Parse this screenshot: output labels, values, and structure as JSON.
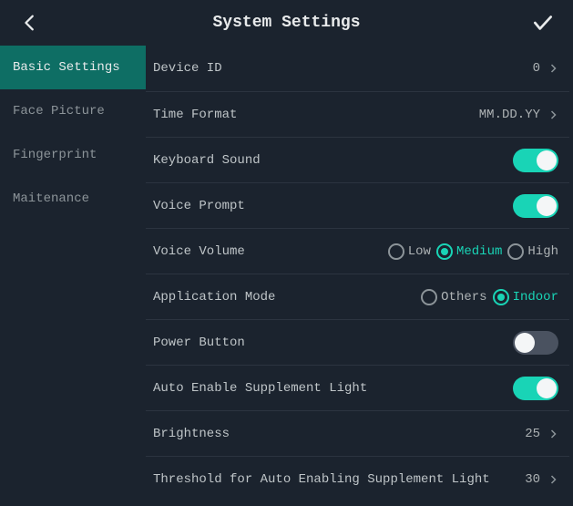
{
  "header": {
    "title": "System Settings"
  },
  "sidebar": {
    "items": [
      {
        "label": "Basic Settings",
        "active": true
      },
      {
        "label": "Face Picture",
        "active": false
      },
      {
        "label": "Fingerprint",
        "active": false
      },
      {
        "label": "Maitenance",
        "active": false
      }
    ]
  },
  "settings": {
    "device_id": {
      "label": "Device ID",
      "value": "0"
    },
    "time_format": {
      "label": "Time Format",
      "value": "MM.DD.YY"
    },
    "keyboard_sound": {
      "label": "Keyboard Sound",
      "on": true
    },
    "voice_prompt": {
      "label": "Voice Prompt",
      "on": true
    },
    "voice_volume": {
      "label": "Voice Volume",
      "options": [
        "Low",
        "Medium",
        "High"
      ],
      "selected": "Medium"
    },
    "application_mode": {
      "label": "Application Mode",
      "options": [
        "Others",
        "Indoor"
      ],
      "selected": "Indoor"
    },
    "power_button": {
      "label": "Power Button",
      "on": false
    },
    "auto_supplement_light": {
      "label": "Auto Enable Supplement Light",
      "on": true
    },
    "brightness": {
      "label": "Brightness",
      "value": "25"
    },
    "threshold_auto_light": {
      "label": "Threshold for Auto Enabling Supplement Light",
      "value": "30"
    }
  }
}
